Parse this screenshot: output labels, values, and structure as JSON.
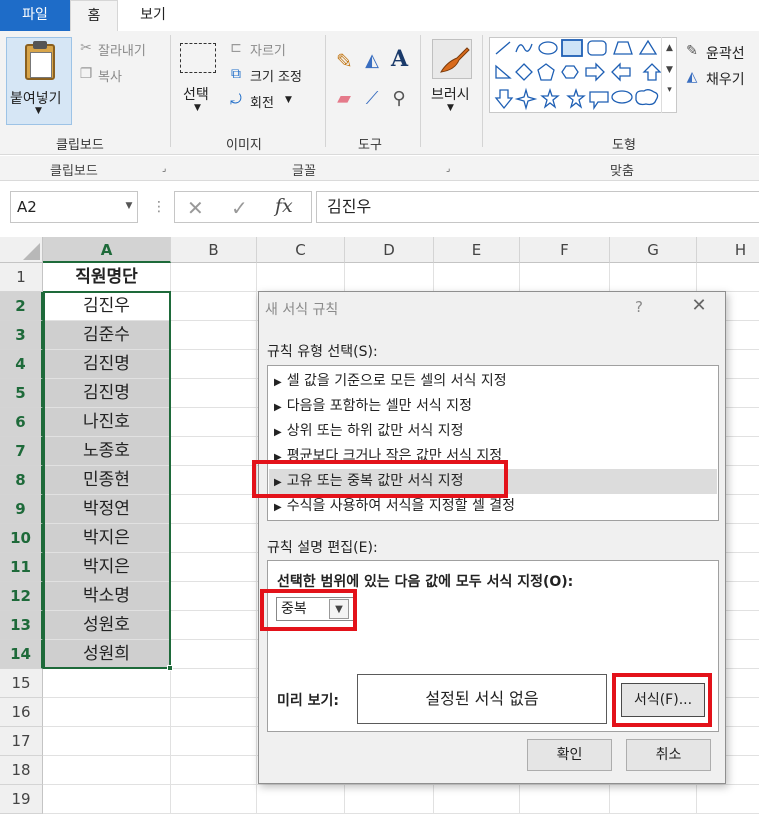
{
  "tabs": {
    "file": "파일",
    "home": "홈",
    "view": "보기"
  },
  "ribbon": {
    "paste": "붙여넣기",
    "cut": "잘라내기",
    "copy": "복사",
    "select": "선택",
    "crop": "자르기",
    "resize": "크기 조정",
    "rotate": "회전",
    "brush": "브러시",
    "outline": "윤곽선",
    "fill": "채우기",
    "groups": {
      "clipboard": "클립보드",
      "image": "이미지",
      "tools": "도구",
      "shapes": "도형"
    },
    "subgroups": {
      "clipboard": "클립보드",
      "font": "글꼴",
      "align": "맞춤"
    }
  },
  "formula_bar": {
    "name_box": "A2",
    "fx": "fx",
    "value": "김진우"
  },
  "sheet": {
    "columns": [
      "A",
      "B",
      "C",
      "D",
      "E",
      "F",
      "G",
      "H"
    ],
    "rows": [
      "1",
      "2",
      "3",
      "4",
      "5",
      "6",
      "7",
      "8",
      "9",
      "10",
      "11",
      "12",
      "13",
      "14",
      "15",
      "16",
      "17",
      "18",
      "19"
    ],
    "a_cells": [
      "직원명단",
      "김진우",
      "김준수",
      "김진명",
      "김진명",
      "나진호",
      "노종호",
      "민종현",
      "박정연",
      "박지은",
      "박지은",
      "박소명",
      "성원호",
      "성원희"
    ]
  },
  "dialog": {
    "title": "새 서식 규칙",
    "help": "?",
    "close": "✕",
    "rule_type_label": "규칙 유형 선택(S):",
    "rules": [
      "셀 값을 기준으로 모든 셀의 서식 지정",
      "다음을 포함하는 셀만 서식 지정",
      "상위 또는 하위 값만 서식 지정",
      "평균보다 크거나 작은 값만 서식 지정",
      "고유 또는 중복 값만 서식 지정",
      "수식을 사용하여 서식을 지정할 셀 결정"
    ],
    "selected_rule_index": 4,
    "edit_label": "규칙 설명 편집(E):",
    "format_all_label": "선택한 범위에 있는 다음 값에 모두 서식 지정(O):",
    "dup_value": "중복",
    "preview_label": "미리 보기:",
    "preview_text": "설정된 서식 없음",
    "format_button": "서식(F)...",
    "ok": "확인",
    "cancel": "취소"
  },
  "colors": {
    "accent": "#1e6cc8",
    "excel_green": "#1e6a3a",
    "highlight": "#e3121a",
    "selected_fill": "#cfcfcf"
  }
}
